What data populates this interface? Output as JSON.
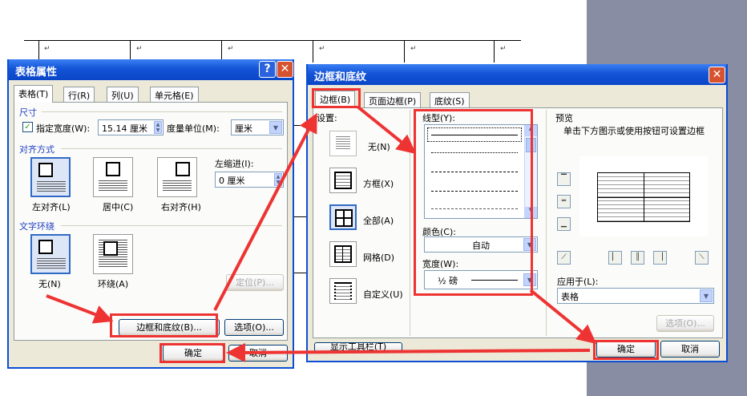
{
  "document": {
    "cell_mark": "↵"
  },
  "table_props": {
    "title": "表格属性",
    "help": "?",
    "close": "✕",
    "tabs": [
      "表格(T)",
      "行(R)",
      "列(U)",
      "单元格(E)"
    ],
    "size_section": "尺寸",
    "preferred_width_label": "指定宽度(W):",
    "preferred_width_value": "15.14 厘米",
    "measure_in_label": "度量单位(M):",
    "measure_in_value": "厘米",
    "alignment_section": "对齐方式",
    "align_options": [
      "左对齐(L)",
      "居中(C)",
      "右对齐(H)"
    ],
    "indent_label": "左缩进(I):",
    "indent_value": "0 厘米",
    "wrap_section": "文字环绕",
    "wrap_options": [
      "无(N)",
      "环绕(A)"
    ],
    "position_button": "定位(P)...",
    "borders_button": "边框和底纹(B)...",
    "options_button": "选项(O)...",
    "ok": "确定",
    "cancel": "取消"
  },
  "borders": {
    "title": "边框和底纹",
    "close": "✕",
    "tabs": [
      "边框(B)",
      "页面边框(P)",
      "底纹(S)"
    ],
    "setting_label": "设置:",
    "settings": [
      "无(N)",
      "方框(X)",
      "全部(A)",
      "网格(D)",
      "自定义(U)"
    ],
    "style_label": "线型(Y):",
    "color_label": "颜色(C):",
    "color_value": "自动",
    "width_label": "宽度(W):",
    "width_value": "½ 磅",
    "preview_label": "预览",
    "preview_hint": "单击下方图示或使用按钮可设置边框",
    "apply_label": "应用于(L):",
    "apply_value": "表格",
    "options_button": "选项(O)...",
    "toolbar_button": "显示工具栏(T)",
    "ok": "确定",
    "cancel": "取消"
  },
  "colors": {
    "highlight": "#e33333",
    "title_bar": "#0a46c8",
    "dialog_bg": "#ece9d8"
  }
}
